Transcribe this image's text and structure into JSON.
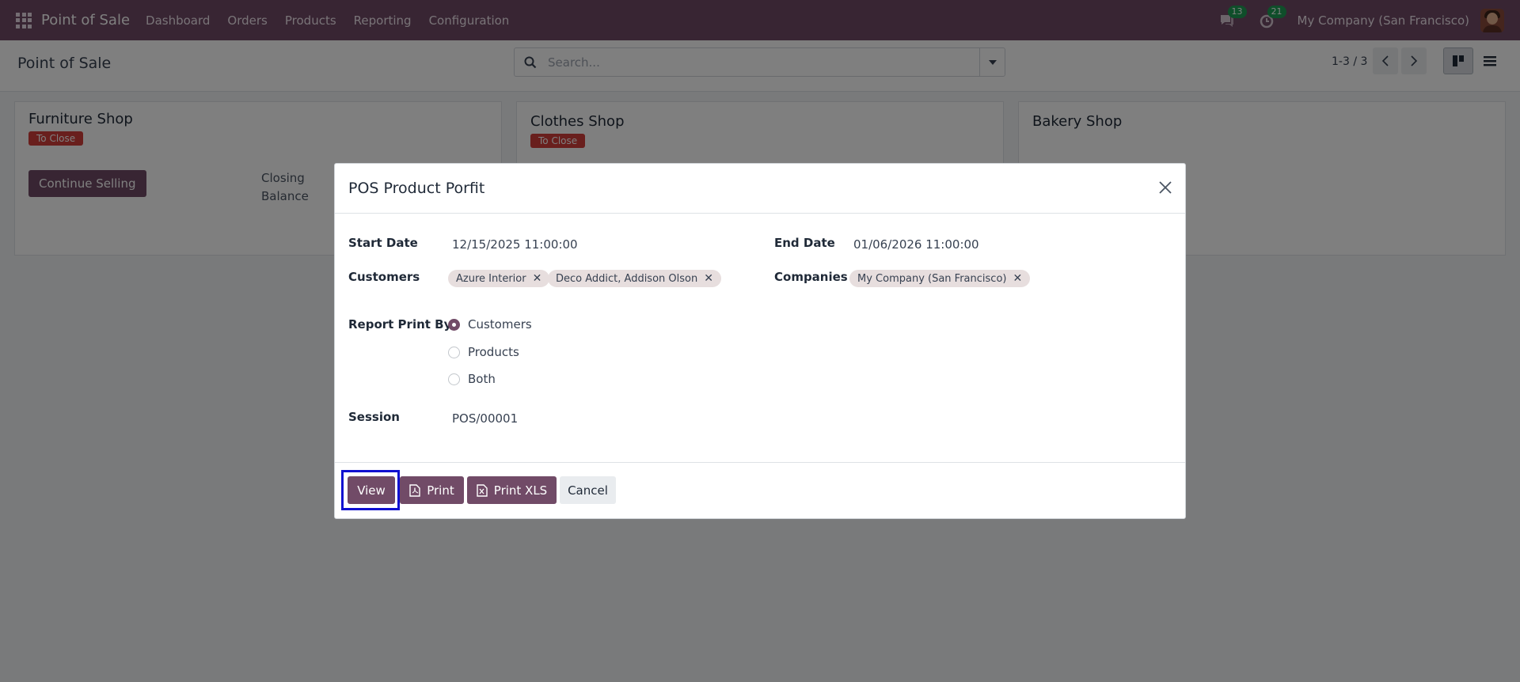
{
  "navbar": {
    "app_name": "Point of Sale",
    "menu": [
      "Dashboard",
      "Orders",
      "Products",
      "Reporting",
      "Configuration"
    ],
    "messages_count": "13",
    "activities_count": "21",
    "company": "My Company (San Francisco)",
    "accent_color": "#714b67"
  },
  "control": {
    "title": "Point of Sale",
    "search_placeholder": "Search...",
    "pager": "1-3 / 3"
  },
  "cards": [
    {
      "name": "Furniture Shop",
      "status": "To Close",
      "button": "Continue Selling",
      "label_line1": "Closing",
      "label_line2": "Balance"
    },
    {
      "name": "Clothes Shop",
      "status": "To Close"
    },
    {
      "name": "Bakery Shop"
    }
  ],
  "dialog": {
    "title": "POS Product Porfit",
    "start_date_label": "Start Date",
    "start_date": "12/15/2025 11:00:00",
    "end_date_label": "End Date",
    "end_date": "01/06/2026 11:00:00",
    "customers_label": "Customers",
    "customers": [
      "Azure Interior",
      "Deco Addict, Addison Olson"
    ],
    "companies_label": "Companies",
    "companies": [
      "My Company (San Francisco)"
    ],
    "report_print_by_label": "Report Print By",
    "report_options": [
      "Customers",
      "Products",
      "Both"
    ],
    "report_selected": "Customers",
    "session_label": "Session",
    "session": "POS/00001",
    "buttons": {
      "view": "View",
      "print": "Print",
      "print_xls": "Print XLS",
      "cancel": "Cancel"
    }
  }
}
